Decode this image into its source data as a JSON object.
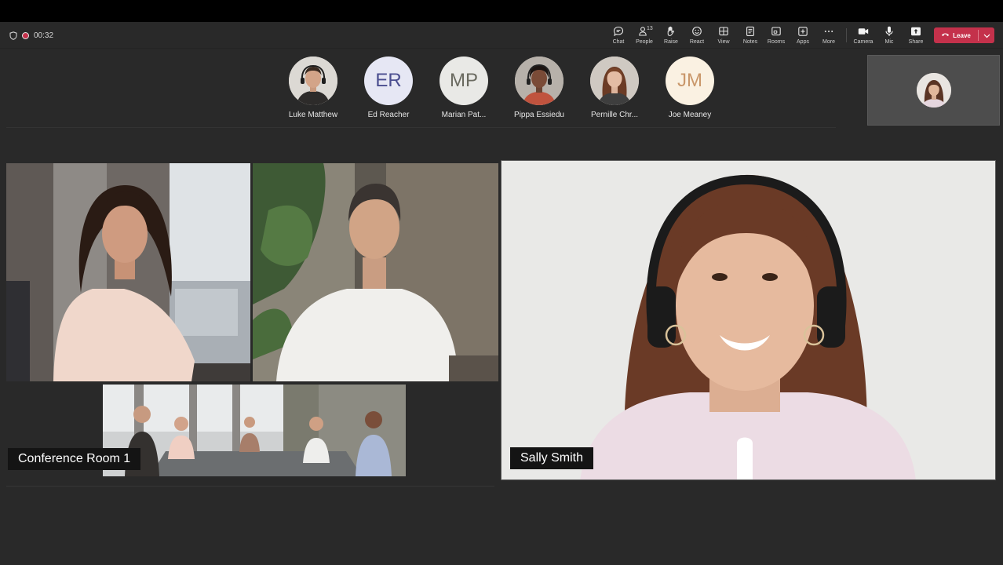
{
  "meeting": {
    "timer": "00:32"
  },
  "toolbar": {
    "chat_label": "Chat",
    "people_label": "People",
    "people_count": "13",
    "raise_label": "Raise",
    "react_label": "React",
    "view_label": "View",
    "notes_label": "Notes",
    "rooms_label": "Rooms",
    "apps_label": "Apps",
    "more_label": "More",
    "camera_label": "Camera",
    "mic_label": "Mic",
    "share_label": "Share",
    "leave_label": "Leave"
  },
  "roster": [
    {
      "name": "Luke Matthew",
      "avatar": "photo"
    },
    {
      "name": "Ed Reacher",
      "initials": "ER"
    },
    {
      "name": "Marian Pat...",
      "initials": "MP"
    },
    {
      "name": "Pippa Essiedu",
      "avatar": "photo"
    },
    {
      "name": "Pernille Chr...",
      "avatar": "photo"
    },
    {
      "name": "Joe Meaney",
      "initials": "JM"
    }
  ],
  "stage": {
    "conference_room_label": "Conference Room 1",
    "active_speaker_label": "Sally Smith"
  },
  "colors": {
    "background": "#292929",
    "leave_button": "#c4314b",
    "name_tag": "#141414"
  }
}
